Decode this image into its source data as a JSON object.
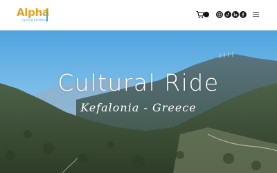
{
  "header": {
    "logo": {
      "name": "Alpha",
      "tagline": "cycling holidays"
    },
    "icons": [
      "cart-icon",
      "instagram-icon",
      "tiktok-icon",
      "linkedin-icon",
      "facebook-icon",
      "hamburger-menu-icon"
    ]
  },
  "hero": {
    "title": "Cultural Ride",
    "subtitle": "Kefalonia - Greece"
  },
  "colors": {
    "logo": "#e4a21c",
    "logo_accent": "#4aa3c9",
    "sky": "#6fb6e6",
    "mountain_far": "#7fa6c4",
    "mountain_mid": "#5d7f95",
    "hills": "#3f5a3a"
  }
}
